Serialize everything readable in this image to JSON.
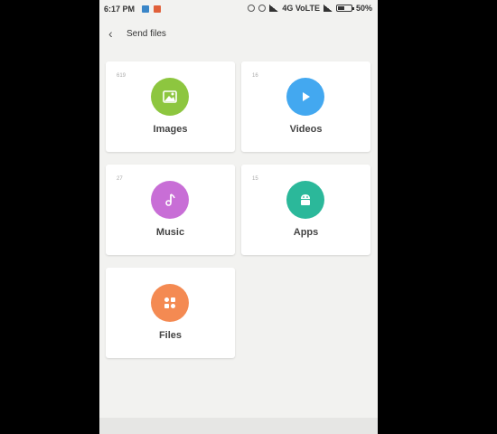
{
  "status_bar": {
    "time": "6:17 PM",
    "network": "4G VoLTE",
    "battery": "50%",
    "battery_level": 0.5
  },
  "header": {
    "back_icon": "chevron-left-icon",
    "title": "Send files"
  },
  "categories": [
    {
      "label": "Images",
      "count": "619",
      "color": "#8dc63f",
      "icon": "image-icon"
    },
    {
      "label": "Videos",
      "count": "16",
      "color": "#43a8f0",
      "icon": "play-icon"
    },
    {
      "label": "Music",
      "count": "27",
      "color": "#c86ed6",
      "icon": "music-note-icon"
    },
    {
      "label": "Apps",
      "count": "15",
      "color": "#2bb89a",
      "icon": "android-icon"
    },
    {
      "label": "Files",
      "count": "",
      "color": "#f48a52",
      "icon": "grid-icon"
    }
  ]
}
